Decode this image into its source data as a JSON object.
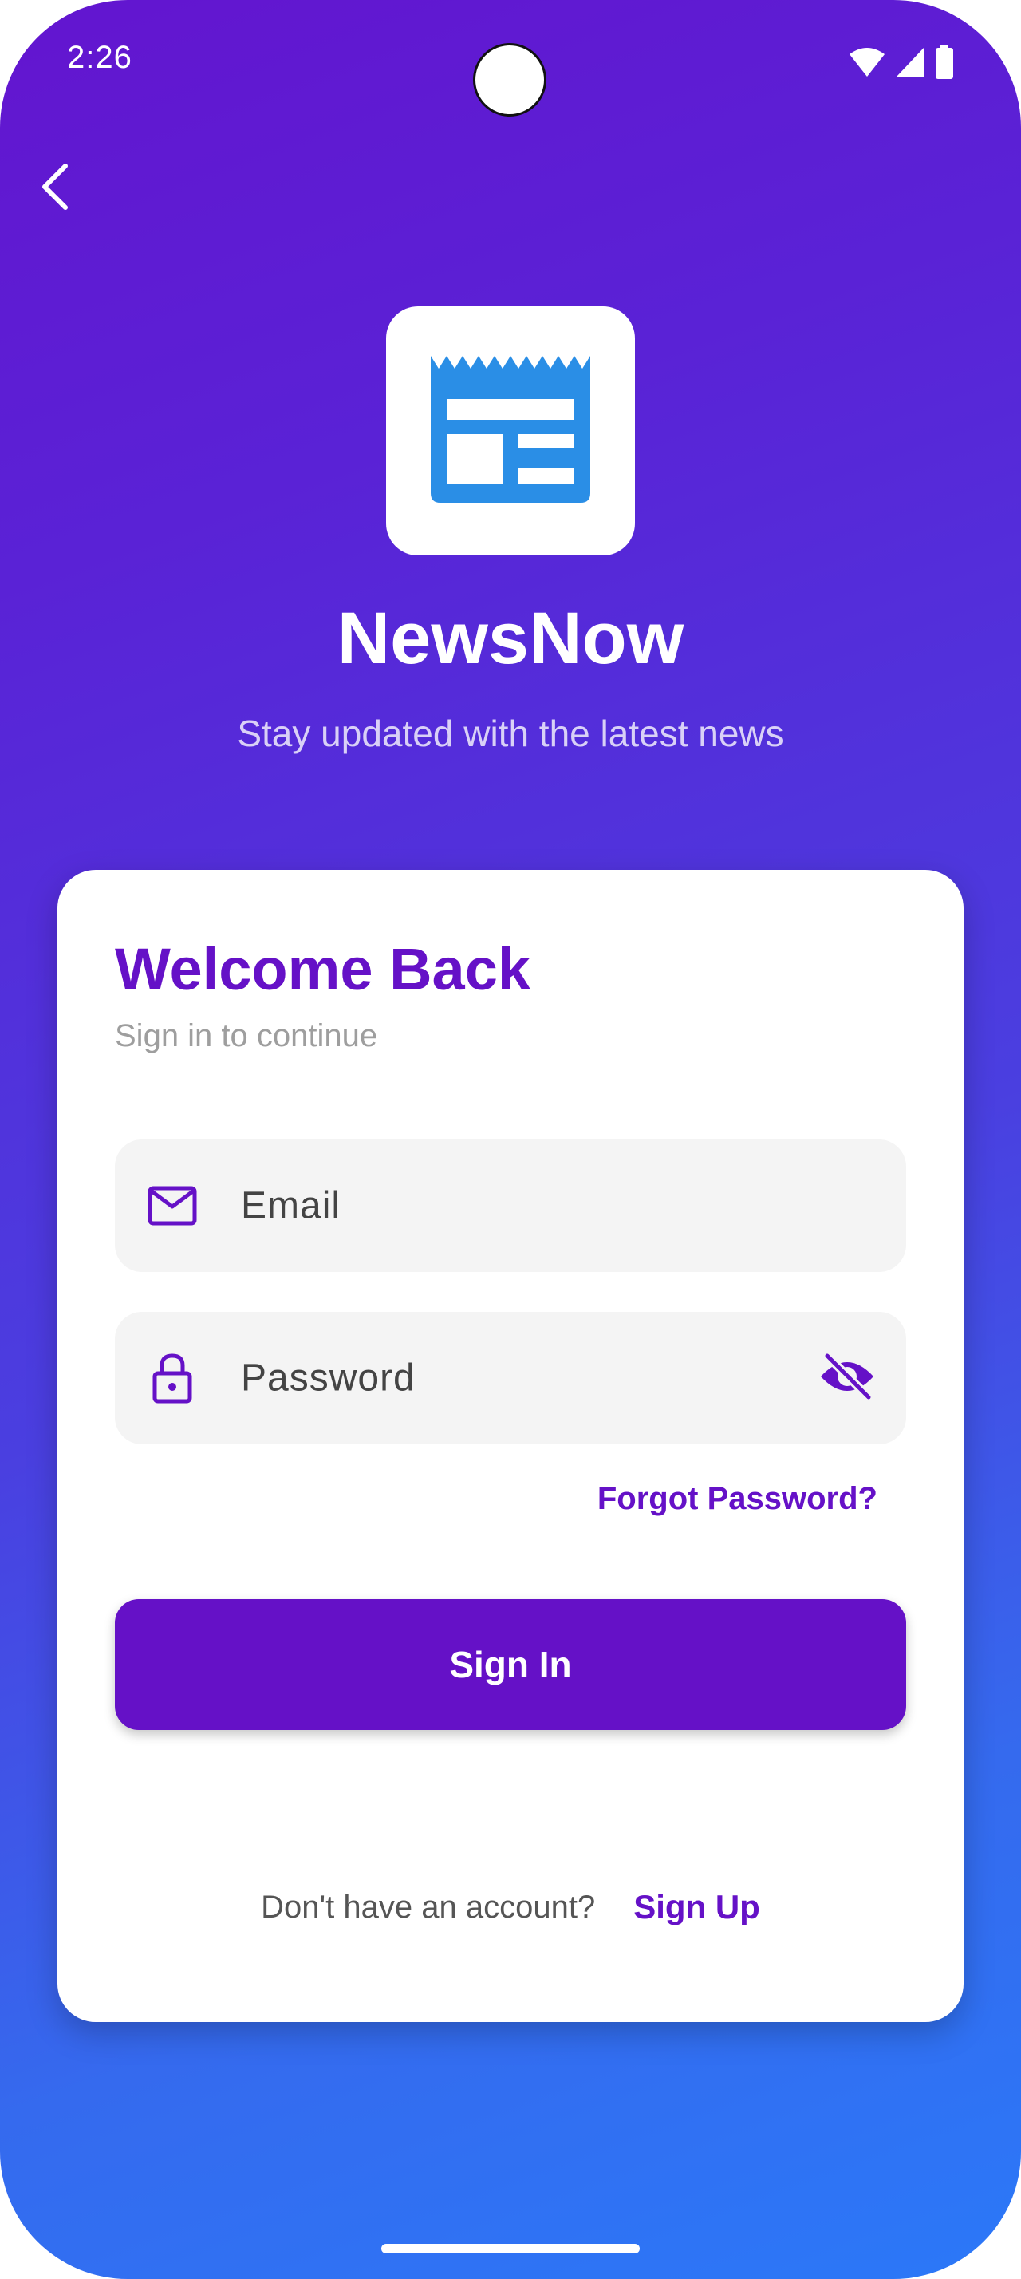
{
  "status_bar": {
    "time": "2:26",
    "icons": [
      "wifi-icon",
      "signal-icon",
      "battery-icon"
    ]
  },
  "header": {
    "back_icon": "chevron-left-icon",
    "logo_icon": "newspaper-icon",
    "app_name": "NewsNow",
    "tagline": "Stay updated with the latest news"
  },
  "login_card": {
    "title": "Welcome Back",
    "subtitle": "Sign in to continue",
    "email_field": {
      "icon": "mail-icon",
      "label": "Email"
    },
    "password_field": {
      "icon": "lock-icon",
      "label": "Password",
      "visibility_icon": "eye-off-icon"
    },
    "forgot_password": "Forgot Password?",
    "sign_in_label": "Sign In",
    "signup_prompt": "Don't have an account?",
    "signup_link": "Sign Up"
  },
  "colors": {
    "primary": "#6511c7",
    "gradient_start": "#6315cf",
    "gradient_end": "#2b78f8",
    "logo_blue": "#2a8ee6",
    "field_background": "#f4f4f4"
  }
}
